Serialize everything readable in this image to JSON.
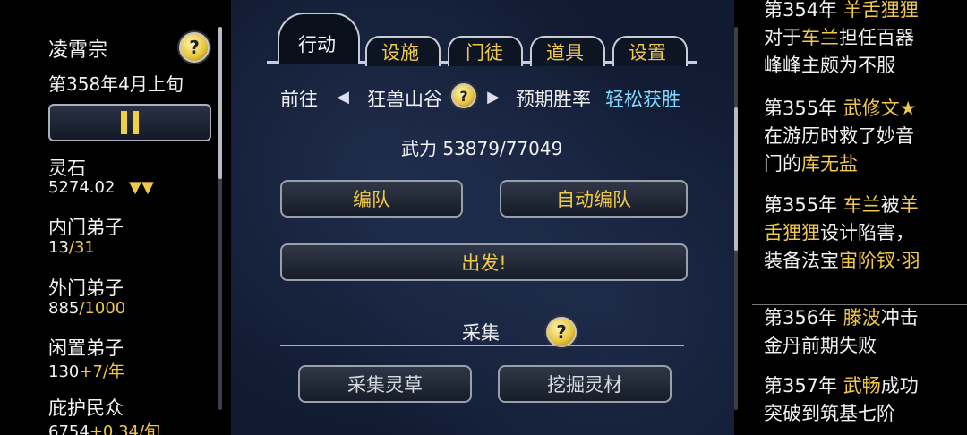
{
  "left": {
    "sect_name": "凌霄宗",
    "date": "第358年4月上旬",
    "stats": [
      {
        "label": "灵石",
        "value": "5274.02",
        "extra": "▼▼"
      },
      {
        "label": "内门弟子",
        "value": "13",
        "extra": "/31"
      },
      {
        "label": "外门弟子",
        "value": "885",
        "extra": "/1000"
      },
      {
        "label": "闲置弟子",
        "value": "130",
        "extra": "+7/年"
      },
      {
        "label": "庇护民众",
        "value": "6754",
        "extra": "+0.34/旬"
      }
    ],
    "help": "?"
  },
  "tabs": [
    "行动",
    "设施",
    "门徒",
    "道具",
    "设置"
  ],
  "action": {
    "goto_label": "前往",
    "destination": "狂兽山谷",
    "expected_label": "预期胜率",
    "expected_value": "轻松获胜",
    "power_label": "武力",
    "power_value": "53879/77049",
    "team_button": "编队",
    "auto_team_button": "自动编队",
    "depart_button": "出发!",
    "gather_title": "采集",
    "gather_herb_button": "采集灵草",
    "gather_material_button": "挖掘灵材"
  },
  "log": [
    {
      "line1_year": "第354年",
      "line1_name": "羊舌狸狸",
      "rest": "对于车兰担任百器峰峰主颇为不服",
      "hl": "车兰"
    },
    {
      "year": "第355年",
      "name": "武修文★",
      "rest_pre": "在游历时救了妙音门的",
      "rest_hl": "库无盐"
    },
    {
      "year": "第355年",
      "name": "车兰",
      "mid": "被",
      "name2": "羊舌狸狸",
      "rest": "设计陷害，装备法宝",
      "item": "宙阶钗·羽"
    },
    {
      "year": "第356年",
      "name": "滕波",
      "rest": "冲击金丹前期失败"
    },
    {
      "year": "第357年",
      "name": "武畅",
      "rest": "成功突破到筑基七阶"
    }
  ]
}
